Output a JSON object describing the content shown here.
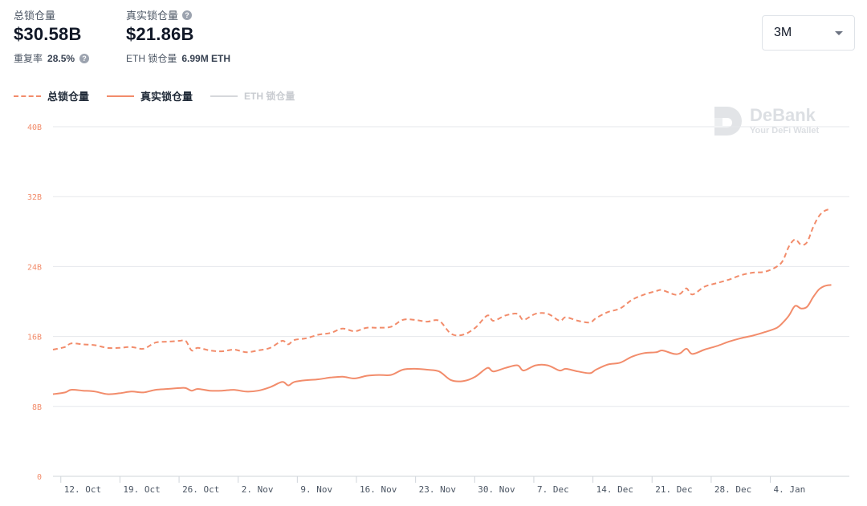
{
  "stats": {
    "total_tvl": {
      "label": "总锁仓量",
      "value": "$30.58B"
    },
    "real_tvl": {
      "label": "真实锁仓量",
      "value": "$21.86B"
    },
    "repeat_rate": {
      "label": "重复率",
      "value": "28.5%"
    },
    "eth_locked": {
      "label": "ETH 锁仓量",
      "value": "6.99M ETH"
    }
  },
  "range_select": {
    "value": "3M"
  },
  "legend": [
    {
      "label": "总锁仓量",
      "style": "dashed",
      "active": true
    },
    {
      "label": "真实锁仓量",
      "style": "solid",
      "active": true
    },
    {
      "label": "ETH 锁仓量",
      "style": "solid",
      "active": false
    }
  ],
  "watermark": {
    "title": "DeBank",
    "subtitle": "Your DeFi Wallet"
  },
  "colors": {
    "series": "#f28c6b",
    "grid": "#e5e7eb",
    "inactive": "#d6d8db"
  },
  "chart_data": {
    "type": "line",
    "title": "",
    "xlabel": "",
    "ylabel": "",
    "ylim": [
      0,
      40
    ],
    "y_unit": "B",
    "y_ticks": [
      "0",
      "8B",
      "16B",
      "24B",
      "32B",
      "40B"
    ],
    "y_tick_values": [
      0,
      8,
      16,
      24,
      32,
      40
    ],
    "x_tick_labels": [
      "12. Oct",
      "19. Oct",
      "26. Oct",
      "2. Nov",
      "9. Nov",
      "16. Nov",
      "23. Nov",
      "30. Nov",
      "7. Dec",
      "14. Dec",
      "21. Dec",
      "28. Dec",
      "4. Jan"
    ],
    "x_tick_days": [
      3,
      10,
      17,
      24,
      31,
      38,
      45,
      52,
      59,
      66,
      73,
      80,
      87
    ],
    "x_range_days": [
      0,
      97
    ],
    "grid": true,
    "legend_position": "top-left",
    "series": [
      {
        "name": "总锁仓量",
        "style": "dashed",
        "points": [
          [
            0,
            14.5
          ],
          [
            2,
            14.8
          ],
          [
            3,
            15.2
          ],
          [
            5,
            15.1
          ],
          [
            7,
            15.0
          ],
          [
            9,
            14.7
          ],
          [
            11,
            14.7
          ],
          [
            13,
            14.8
          ],
          [
            15,
            14.6
          ],
          [
            17,
            15.3
          ],
          [
            19,
            15.4
          ],
          [
            21,
            15.5
          ],
          [
            22,
            15.5
          ],
          [
            23,
            14.4
          ],
          [
            24,
            14.7
          ],
          [
            26,
            14.4
          ],
          [
            28,
            14.3
          ],
          [
            30,
            14.5
          ],
          [
            32,
            14.2
          ],
          [
            34,
            14.4
          ],
          [
            36,
            14.7
          ],
          [
            38,
            15.5
          ],
          [
            39,
            15.1
          ],
          [
            40,
            15.6
          ],
          [
            42,
            15.8
          ],
          [
            44,
            16.2
          ],
          [
            46,
            16.4
          ],
          [
            48,
            16.9
          ],
          [
            50,
            16.6
          ],
          [
            52,
            17.0
          ],
          [
            54,
            17.0
          ],
          [
            56,
            17.1
          ],
          [
            58,
            17.9
          ],
          [
            60,
            17.9
          ],
          [
            62,
            17.7
          ],
          [
            64,
            17.8
          ],
          [
            66,
            16.3
          ],
          [
            68,
            16.2
          ],
          [
            70,
            17.0
          ],
          [
            72,
            18.4
          ],
          [
            73,
            17.8
          ],
          [
            75,
            18.4
          ],
          [
            77,
            18.6
          ],
          [
            78,
            17.9
          ],
          [
            80,
            18.6
          ],
          [
            82,
            18.6
          ],
          [
            84,
            17.8
          ],
          [
            85,
            18.2
          ],
          [
            87,
            17.8
          ],
          [
            89,
            17.6
          ],
          [
            90,
            18.1
          ],
          [
            92,
            18.8
          ],
          [
            94,
            19.2
          ],
          [
            96,
            20.2
          ],
          [
            98,
            20.8
          ],
          [
            100,
            21.2
          ],
          [
            101,
            21.3
          ],
          [
            103,
            20.8
          ],
          [
            104,
            20.9
          ],
          [
            105,
            21.5
          ],
          [
            106,
            20.8
          ],
          [
            108,
            21.7
          ],
          [
            110,
            22.1
          ],
          [
            112,
            22.5
          ],
          [
            114,
            23.0
          ],
          [
            116,
            23.3
          ],
          [
            118,
            23.4
          ],
          [
            120,
            24.0
          ],
          [
            121,
            24.7
          ],
          [
            122,
            26.3
          ],
          [
            123,
            27.1
          ],
          [
            124,
            26.5
          ],
          [
            125,
            26.8
          ],
          [
            126,
            28.5
          ],
          [
            127,
            29.8
          ],
          [
            128,
            30.4
          ],
          [
            129,
            30.6
          ]
        ]
      },
      {
        "name": "真实锁仓量",
        "style": "solid",
        "points": [
          [
            0,
            9.4
          ],
          [
            2,
            9.6
          ],
          [
            3,
            9.9
          ],
          [
            5,
            9.8
          ],
          [
            7,
            9.7
          ],
          [
            9,
            9.4
          ],
          [
            11,
            9.5
          ],
          [
            13,
            9.7
          ],
          [
            15,
            9.6
          ],
          [
            17,
            9.9
          ],
          [
            19,
            10.0
          ],
          [
            21,
            10.1
          ],
          [
            22,
            10.1
          ],
          [
            23,
            9.8
          ],
          [
            24,
            10.0
          ],
          [
            26,
            9.8
          ],
          [
            28,
            9.8
          ],
          [
            30,
            9.9
          ],
          [
            32,
            9.7
          ],
          [
            34,
            9.8
          ],
          [
            36,
            10.2
          ],
          [
            38,
            10.8
          ],
          [
            39,
            10.4
          ],
          [
            40,
            10.8
          ],
          [
            42,
            11.0
          ],
          [
            44,
            11.1
          ],
          [
            46,
            11.3
          ],
          [
            48,
            11.4
          ],
          [
            50,
            11.2
          ],
          [
            52,
            11.5
          ],
          [
            54,
            11.6
          ],
          [
            56,
            11.6
          ],
          [
            58,
            12.2
          ],
          [
            60,
            12.3
          ],
          [
            62,
            12.2
          ],
          [
            64,
            12.0
          ],
          [
            66,
            11.0
          ],
          [
            68,
            10.9
          ],
          [
            70,
            11.4
          ],
          [
            72,
            12.4
          ],
          [
            73,
            12.0
          ],
          [
            75,
            12.4
          ],
          [
            77,
            12.7
          ],
          [
            78,
            12.1
          ],
          [
            80,
            12.7
          ],
          [
            82,
            12.7
          ],
          [
            84,
            12.1
          ],
          [
            85,
            12.3
          ],
          [
            87,
            12.0
          ],
          [
            89,
            11.8
          ],
          [
            90,
            12.2
          ],
          [
            92,
            12.8
          ],
          [
            94,
            13.0
          ],
          [
            96,
            13.7
          ],
          [
            98,
            14.1
          ],
          [
            100,
            14.2
          ],
          [
            101,
            14.4
          ],
          [
            103,
            14.0
          ],
          [
            104,
            14.1
          ],
          [
            105,
            14.6
          ],
          [
            106,
            14.0
          ],
          [
            108,
            14.5
          ],
          [
            110,
            14.9
          ],
          [
            112,
            15.4
          ],
          [
            114,
            15.8
          ],
          [
            116,
            16.1
          ],
          [
            118,
            16.5
          ],
          [
            120,
            17.0
          ],
          [
            121,
            17.6
          ],
          [
            122,
            18.4
          ],
          [
            123,
            19.5
          ],
          [
            124,
            19.2
          ],
          [
            125,
            19.4
          ],
          [
            126,
            20.5
          ],
          [
            127,
            21.4
          ],
          [
            128,
            21.8
          ],
          [
            129,
            21.9
          ]
        ]
      }
    ]
  }
}
